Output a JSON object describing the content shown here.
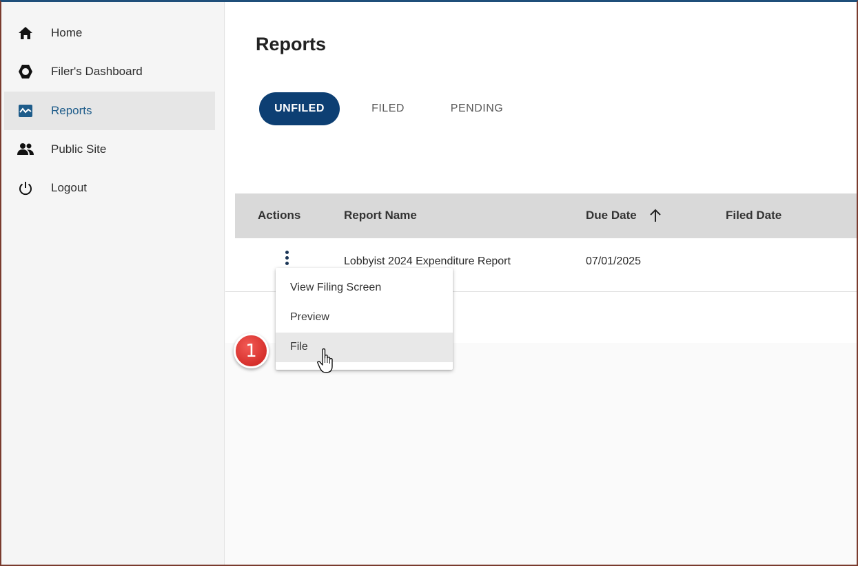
{
  "sidebar": {
    "items": [
      {
        "label": "Home",
        "icon": "home-icon"
      },
      {
        "label": "Filer's Dashboard",
        "icon": "gear-icon"
      },
      {
        "label": "Reports",
        "icon": "reports-chart-icon",
        "active": true
      },
      {
        "label": "Public Site",
        "icon": "people-icon"
      },
      {
        "label": "Logout",
        "icon": "power-icon"
      }
    ]
  },
  "main": {
    "title": "Reports",
    "tabs": [
      {
        "label": "UNFILED",
        "active": true
      },
      {
        "label": "FILED"
      },
      {
        "label": "PENDING"
      }
    ],
    "table": {
      "columns": [
        "Actions",
        "Report Name",
        "Due Date",
        "Filed Date"
      ],
      "sort_column": "Due Date",
      "sort_direction": "ascending",
      "rows": [
        {
          "report_name": "Lobbyist 2024 Expenditure Report",
          "due_date": "07/01/2025",
          "filed_date": ""
        }
      ]
    }
  },
  "actions_menu": {
    "items": [
      "View Filing Screen",
      "Preview",
      "File"
    ],
    "hovered": "File"
  },
  "step_badge": "1",
  "colors": {
    "accent": "#0d3f73",
    "active_nav_text": "#1e5c8a",
    "badge": "#d6302c",
    "header_bg": "#d9d9d9"
  }
}
